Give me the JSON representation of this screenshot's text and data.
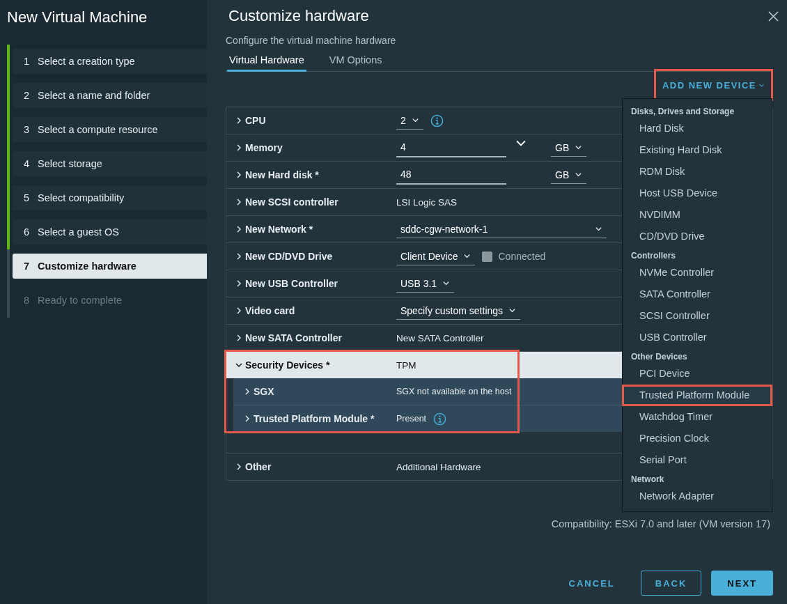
{
  "sidebar": {
    "title": "New Virtual Machine",
    "steps": [
      {
        "number": "1",
        "label": "Select a creation type",
        "completed": true,
        "selected": false,
        "disabled": false
      },
      {
        "number": "2",
        "label": "Select a name and folder",
        "completed": true,
        "selected": false,
        "disabled": false
      },
      {
        "number": "3",
        "label": "Select a compute resource",
        "completed": true,
        "selected": false,
        "disabled": false
      },
      {
        "number": "4",
        "label": "Select storage",
        "completed": true,
        "selected": false,
        "disabled": false
      },
      {
        "number": "5",
        "label": "Select compatibility",
        "completed": true,
        "selected": false,
        "disabled": false
      },
      {
        "number": "6",
        "label": "Select a guest OS",
        "completed": true,
        "selected": false,
        "disabled": false
      },
      {
        "number": "7",
        "label": "Customize hardware",
        "completed": false,
        "selected": true,
        "disabled": false
      },
      {
        "number": "8",
        "label": "Ready to complete",
        "completed": false,
        "selected": false,
        "disabled": true
      }
    ]
  },
  "header": {
    "title": "Customize hardware",
    "subtitle": "Configure the virtual machine hardware"
  },
  "tabs": [
    {
      "label": "Virtual Hardware",
      "selected": true
    },
    {
      "label": "VM Options",
      "selected": false
    }
  ],
  "add_device": {
    "label": "ADD NEW DEVICE",
    "highlighted": true
  },
  "hardware": [
    {
      "label": "CPU",
      "kind": "select",
      "value": "2",
      "info": true,
      "expanded": false
    },
    {
      "label": "Memory",
      "kind": "input",
      "value": "4",
      "presets": true,
      "unit": "GB",
      "expanded": false
    },
    {
      "label": "New Hard disk *",
      "kind": "input",
      "value": "48",
      "unit": "GB",
      "expanded": false
    },
    {
      "label": "New SCSI controller",
      "kind": "text",
      "value": "LSI Logic SAS",
      "expanded": false
    },
    {
      "label": "New Network *",
      "kind": "wide-select",
      "value": "sddc-cgw-network-1",
      "expanded": false
    },
    {
      "label": "New CD/DVD Drive",
      "kind": "select",
      "value": "Client Device",
      "checkbox": {
        "label": "Connected",
        "checked": false
      },
      "expanded": false
    },
    {
      "label": "New USB Controller",
      "kind": "select",
      "value": "USB 3.1",
      "expanded": false
    },
    {
      "label": "Video card",
      "kind": "select",
      "value": "Specify custom settings",
      "expanded": false
    },
    {
      "label": "New SATA Controller",
      "kind": "text",
      "value": "New SATA Controller",
      "expanded": false
    },
    {
      "label": "Security Devices *",
      "kind": "text",
      "value": "TPM",
      "expanded": true,
      "highlighted": true,
      "children": [
        {
          "label": "SGX",
          "kind": "text",
          "value": "SGX not available on the host",
          "expanded": false
        },
        {
          "label": "Trusted Platform Module *",
          "kind": "text",
          "value": "Present",
          "info": true,
          "expanded": false
        }
      ]
    },
    {
      "label": "Other",
      "kind": "text",
      "value": "Additional Hardware",
      "expanded": false
    }
  ],
  "compatibility": "Compatibility: ESXi 7.0 and later (VM version 17)",
  "device_menu": {
    "groups": [
      {
        "heading": "Disks, Drives and Storage",
        "items": [
          {
            "label": "Hard Disk",
            "highlighted": false
          },
          {
            "label": "Existing Hard Disk",
            "highlighted": false
          },
          {
            "label": "RDM Disk",
            "highlighted": false
          },
          {
            "label": "Host USB Device",
            "highlighted": false
          },
          {
            "label": "NVDIMM",
            "highlighted": false
          },
          {
            "label": "CD/DVD Drive",
            "highlighted": false
          }
        ]
      },
      {
        "heading": "Controllers",
        "items": [
          {
            "label": "NVMe Controller",
            "highlighted": false
          },
          {
            "label": "SATA Controller",
            "highlighted": false
          },
          {
            "label": "SCSI Controller",
            "highlighted": false
          },
          {
            "label": "USB Controller",
            "highlighted": false
          }
        ]
      },
      {
        "heading": "Other Devices",
        "items": [
          {
            "label": "PCI Device",
            "highlighted": false
          },
          {
            "label": "Trusted Platform Module",
            "highlighted": true
          },
          {
            "label": "Watchdog Timer",
            "highlighted": false
          },
          {
            "label": "Precision Clock",
            "highlighted": false
          },
          {
            "label": "Serial Port",
            "highlighted": false
          }
        ]
      },
      {
        "heading": "Network",
        "items": [
          {
            "label": "Network Adapter",
            "highlighted": false
          }
        ]
      }
    ]
  },
  "footer": {
    "cancel": "CANCEL",
    "back": "BACK",
    "next": "NEXT"
  }
}
